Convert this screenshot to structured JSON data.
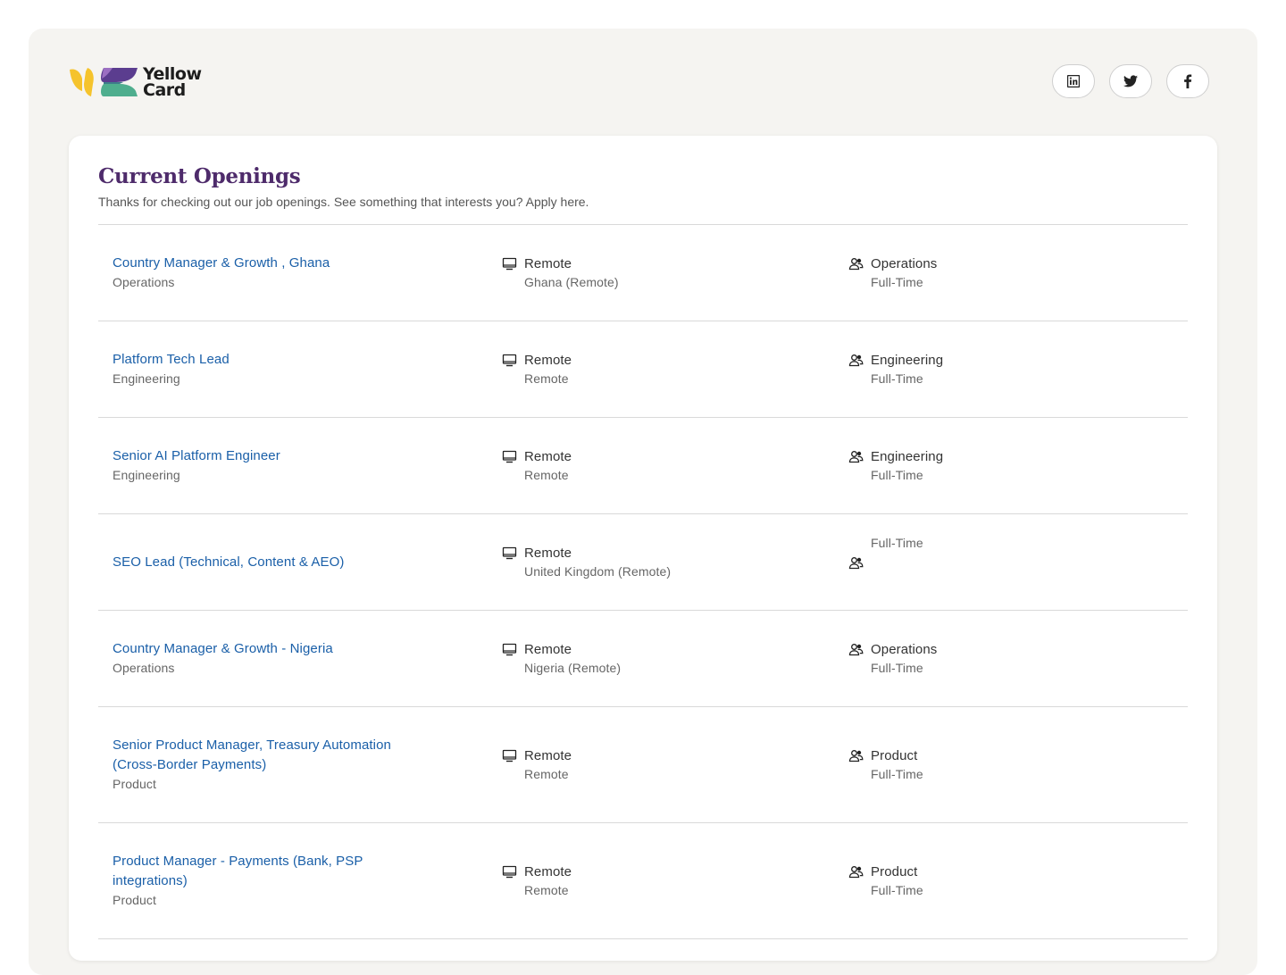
{
  "brand": {
    "logo_line1": "Yellow",
    "logo_line2": "Card"
  },
  "social": [
    {
      "icon": "linkedin-icon"
    },
    {
      "icon": "twitter-icon"
    },
    {
      "icon": "facebook-icon"
    }
  ],
  "openings": {
    "title": "Current Openings",
    "subtitle": "Thanks for checking out our job openings. See something that interests you? Apply here.",
    "jobs": [
      {
        "title": "Country Manager & Growth , Ghana",
        "department": "Operations",
        "workplace": "Remote",
        "location": "Ghana (Remote)",
        "team": "Operations",
        "employment": "Full-Time"
      },
      {
        "title": "Platform Tech Lead",
        "department": "Engineering",
        "workplace": "Remote",
        "location": "Remote",
        "team": "Engineering",
        "employment": "Full-Time"
      },
      {
        "title": "Senior AI Platform Engineer",
        "department": "Engineering",
        "workplace": "Remote",
        "location": "Remote",
        "team": "Engineering",
        "employment": "Full-Time"
      },
      {
        "title": "SEO Lead (Technical, Content & AEO)",
        "department": "",
        "workplace": "Remote",
        "location": "United Kingdom (Remote)",
        "team": "",
        "employment": "Full-Time"
      },
      {
        "title": "Country Manager & Growth - Nigeria",
        "department": "Operations",
        "workplace": "Remote",
        "location": "Nigeria (Remote)",
        "team": "Operations",
        "employment": "Full-Time"
      },
      {
        "title": "Senior Product Manager, Treasury Automation (Cross-Border Payments)",
        "department": "Product",
        "workplace": "Remote",
        "location": "Remote",
        "team": "Product",
        "employment": "Full-Time"
      },
      {
        "title": "Product Manager - Payments (Bank, PSP integrations)",
        "department": "Product",
        "workplace": "Remote",
        "location": "Remote",
        "team": "Product",
        "employment": "Full-Time"
      }
    ]
  },
  "colors": {
    "heading": "#4e2b6b",
    "link": "#1a5fa8",
    "logo_yellow": "#f5c32c",
    "logo_purple": "#5b3d8f",
    "logo_green": "#4fae8e"
  }
}
